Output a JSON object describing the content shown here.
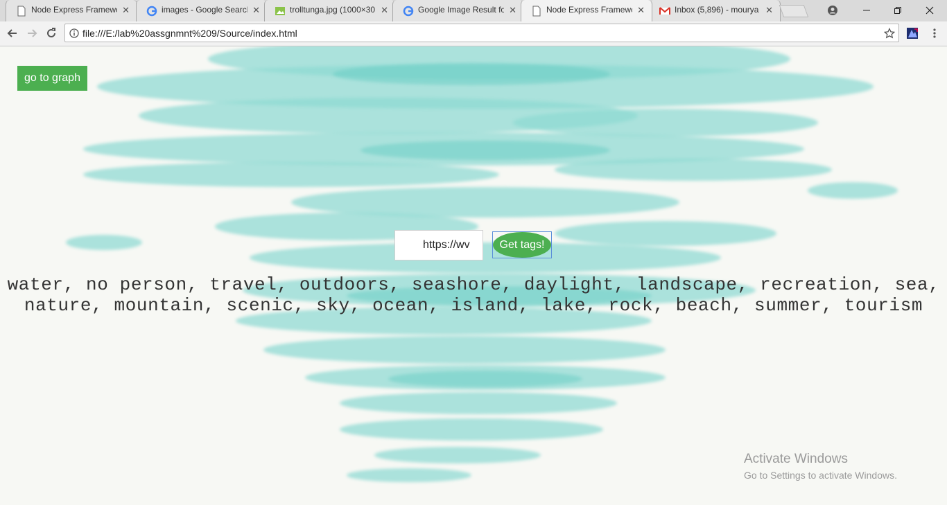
{
  "browser": {
    "tabs": [
      {
        "title": "Node Express Framewo",
        "icon": "document-icon",
        "active": false
      },
      {
        "title": "images - Google Search",
        "icon": "google-icon",
        "active": false
      },
      {
        "title": "trolltunga.jpg (1000×30",
        "icon": "image-icon",
        "active": false
      },
      {
        "title": "Google Image Result fo",
        "icon": "google-icon",
        "active": false
      },
      {
        "title": "Node Express Framewo",
        "icon": "document-icon",
        "active": true
      },
      {
        "title": "Inbox (5,896) - mourya",
        "icon": "gmail-icon",
        "active": false
      }
    ],
    "url": "file:///E:/lab%20assgnmnt%209/Source/index.html"
  },
  "page": {
    "graph_button": "go to graph",
    "url_input_value": "https://wv",
    "tags_button": "Get tags!",
    "tags_line1": "water, no person, travel, outdoors, seashore, daylight, landscape, recreation, sea,",
    "tags_line2": "nature, mountain, scenic, sky, ocean, island, lake, rock, beach, summer, tourism"
  },
  "watermark": {
    "title": "Activate Windows",
    "subtitle": "Go to Settings to activate Windows."
  },
  "colors": {
    "button_green": "#4caf50",
    "watercolor": "#7fd6d0"
  }
}
